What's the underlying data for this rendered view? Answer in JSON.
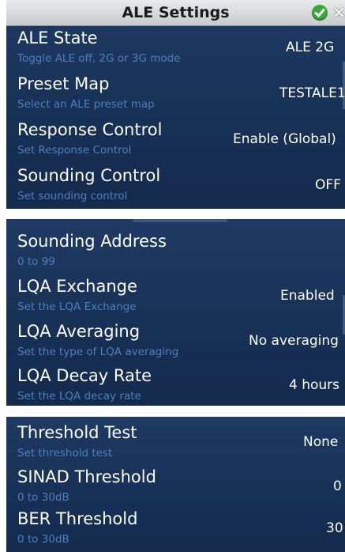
{
  "title": "ALE Settings",
  "icons": {
    "confirm": "check-circle-icon",
    "close": "close-icon"
  },
  "colors": {
    "panel": "#1b355d",
    "title_bar": "#d5d7d9",
    "subtitle": "#4f7fbf",
    "text": "#ffffff",
    "confirm": "#3aa83a"
  },
  "panels": [
    {
      "rows": [
        {
          "label": "ALE State",
          "description": "Toggle ALE off, 2G or 3G mode",
          "value": "ALE 2G"
        },
        {
          "label": "Preset Map",
          "description": "Select an ALE preset map",
          "value": "TESTALE1"
        },
        {
          "label": "Response Control",
          "description": "Set Response Control",
          "value": "Enable (Global)"
        },
        {
          "label": "Sounding Control",
          "description": "Set sounding control",
          "value": "OFF"
        }
      ]
    },
    {
      "rows": [
        {
          "label": "Sounding Address",
          "description": "0 to 99",
          "value": ""
        },
        {
          "label": "LQA Exchange",
          "description": "Set the LQA Exchange",
          "value": "Enabled"
        },
        {
          "label": "LQA Averaging",
          "description": "Set the type of LQA averaging",
          "value": "No averaging"
        },
        {
          "label": "LQA Decay Rate",
          "description": "Set the LQA decay rate",
          "value": "4 hours"
        }
      ]
    },
    {
      "rows": [
        {
          "label": "Threshold Test",
          "description": "Set threshold test",
          "value": "None"
        },
        {
          "label": "SINAD Threshold",
          "description": "0 to 30dB",
          "value": "0"
        },
        {
          "label": "BER Threshold",
          "description": "0 to 30dB",
          "value": "30"
        }
      ]
    }
  ]
}
